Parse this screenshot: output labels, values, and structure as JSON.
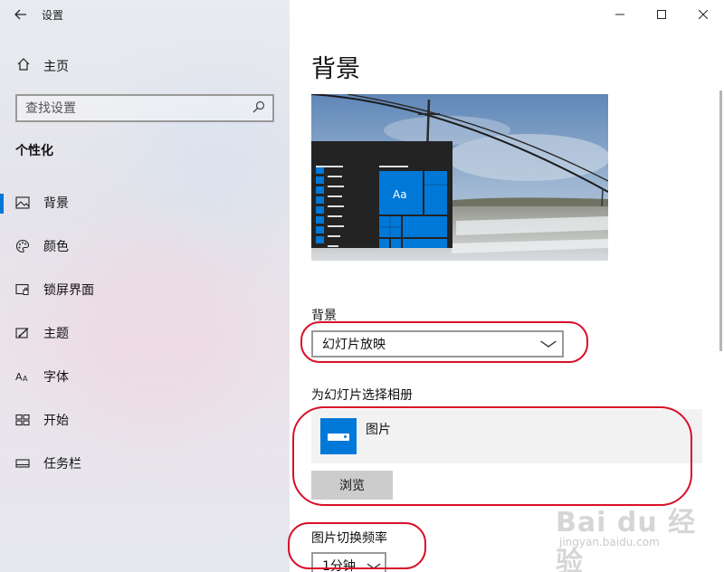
{
  "window": {
    "title": "设置",
    "controls": {
      "minimize": "—",
      "maximize": "☐",
      "close": "✕"
    }
  },
  "sidebar": {
    "back_icon": "arrow-left-icon",
    "home_label": "主页",
    "search_placeholder": "查找设置",
    "section": "个性化",
    "selected_index": 0,
    "items": [
      {
        "label": "背景",
        "icon": "picture-icon"
      },
      {
        "label": "颜色",
        "icon": "palette-icon"
      },
      {
        "label": "锁屏界面",
        "icon": "lock-screen-icon"
      },
      {
        "label": "主题",
        "icon": "theme-brush-icon"
      },
      {
        "label": "字体",
        "icon": "font-icon"
      },
      {
        "label": "开始",
        "icon": "start-grid-icon"
      },
      {
        "label": "任务栏",
        "icon": "taskbar-icon"
      }
    ]
  },
  "main": {
    "title": "背景",
    "preview_tile_label": "Aa",
    "background_label": "背景",
    "background_value": "幻灯片放映",
    "album_label": "为幻灯片选择相册",
    "album_name": "图片",
    "browse_label": "浏览",
    "frequency_label": "图片切换频率",
    "frequency_value": "1分钟"
  },
  "colors": {
    "accent": "#0078d7",
    "annotation": "#d8102a"
  },
  "watermark": {
    "brand": "Bai du 经验",
    "url": "jingyan.baidu.com"
  }
}
